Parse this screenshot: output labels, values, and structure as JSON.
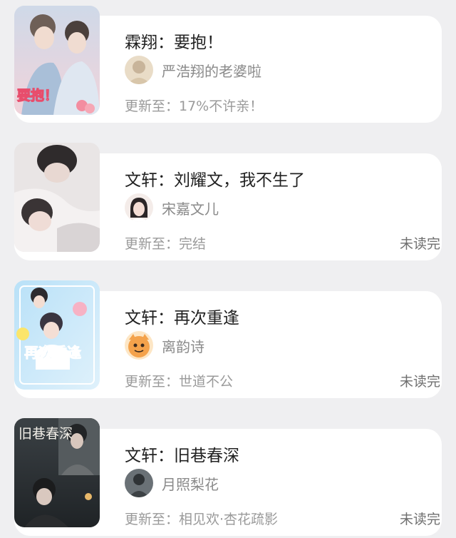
{
  "books": [
    {
      "title": "霖翔：要抱！",
      "author": "严浩翔的老婆啦",
      "update": "更新至：17%不许亲！",
      "status": "",
      "cover_text": "要抱！",
      "cover_colors": [
        "#c9d6e6",
        "#f2c7cf"
      ],
      "avatar_color": "#e7d9c1"
    },
    {
      "title": "文轩：刘耀文，我不生了",
      "author": "宋嘉文儿",
      "update": "更新至：完结",
      "status": "未读完",
      "cover_text": "",
      "cover_colors": [
        "#e8e2e2",
        "#bfb6b8"
      ],
      "avatar_color": "#f3e7e3"
    },
    {
      "title": "文轩：再次重逢",
      "author": "离韵诗",
      "update": "更新至：世道不公",
      "status": "未读完",
      "cover_text": "再次重逢",
      "cover_colors": [
        "#bfe2f7",
        "#fdf3b0"
      ],
      "avatar_color": "#f4a24b"
    },
    {
      "title": "文轩：旧巷春深",
      "author": "月照梨花",
      "update": "更新至：相见欢·杏花疏影",
      "status": "未读完",
      "cover_text": "旧巷春深",
      "cover_colors": [
        "#2d3236",
        "#5a5e5f"
      ],
      "avatar_color": "#4d5459"
    }
  ]
}
